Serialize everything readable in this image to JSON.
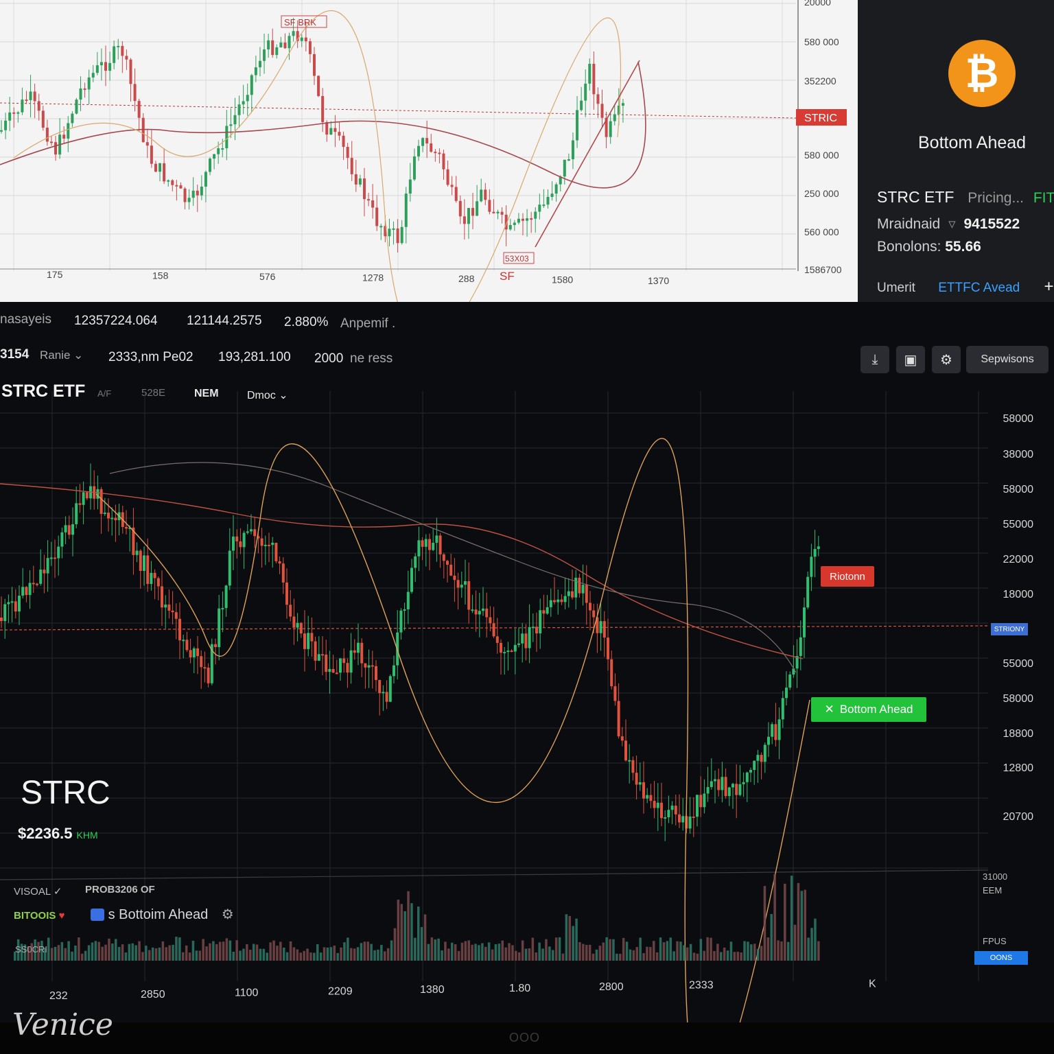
{
  "top_chart": {
    "y_ticks": [
      "20000",
      "580 000",
      "352200",
      "580 000",
      "250 000",
      "560 000",
      "1586700"
    ],
    "x_ticks": [
      "175",
      "158",
      "576",
      "1278",
      "288",
      "1580",
      "1370"
    ],
    "price_tag": "STRIC",
    "x_marker": "SF",
    "top_label": "SF BRK",
    "bottom_label": "53X03"
  },
  "info_panel": {
    "icon": "bitcoin-icon",
    "title": "Bottom Ahead",
    "etf_label": "STRC ETF",
    "pricing_label": "Pricing...",
    "pricing_flag": "FIT",
    "row1_label": "Mraidnaid",
    "row1_value": "9415522",
    "row2_label": "Bonolons:",
    "row2_value": "55.66",
    "row3_label": "Umerit",
    "row3_link": "ETTFC Avead",
    "plus": "+"
  },
  "stats_bar": {
    "label": "nasayeis",
    "v1": "12357224.064",
    "v2": "121144.2575",
    "pct": "2.880%",
    "note": "Anpemif ."
  },
  "sub_bar": {
    "code": "3154",
    "range_label": "Ranie",
    "a": "2333,nm Pe02",
    "b": "193,281.100",
    "c": "2000",
    "d": "ne ress",
    "button": "Sepwisons"
  },
  "chart_tabs": {
    "symbol": "STRC ETF",
    "sub": "A/F",
    "tab1": "528E",
    "tab2": "NEM",
    "tab3": "Dmoc"
  },
  "main_chart": {
    "y_ticks": [
      "58000",
      "38000",
      "58000",
      "55000",
      "22000",
      "18000",
      "55000",
      "58000",
      "18800",
      "12800",
      "20700"
    ],
    "vol_ticks": [
      "31000",
      "EEM",
      "FPUS"
    ],
    "x_ticks": [
      "232",
      "2850",
      "1100",
      "2209",
      "1380",
      "1.80",
      "2800",
      "2333",
      "K"
    ],
    "price_line_tag": "STRIONY",
    "red_tag": "Riotonn",
    "green_tag": "Bottom Ahead",
    "blue_tag": "OONS",
    "symbol": "STRC",
    "price": "$2236.5",
    "price_unit": "KHM"
  },
  "volume_panel": {
    "label1": "VISOAL",
    "label2": "PROB3206 OF",
    "label3": "BITOOIS",
    "label4": "s Bottoim Ahead",
    "label5": "SS0CRI"
  },
  "watermark": "Venice",
  "bezel_logo": "OOO",
  "colors": {
    "up": "#2fbf71",
    "down": "#e0533d",
    "accent": "#3aa0ff",
    "bitcoin": "#f2931a"
  }
}
